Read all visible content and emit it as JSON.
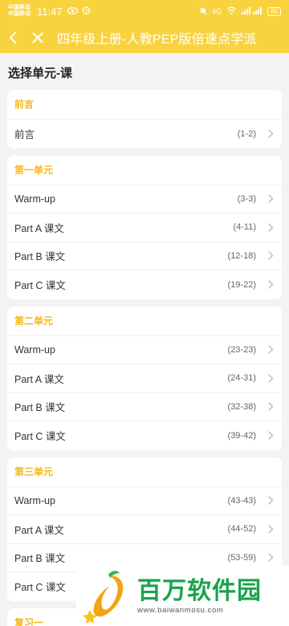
{
  "status_bar": {
    "carrier1": "中国移动",
    "carrier2": "中国移动",
    "time": "11:47",
    "network": "4G",
    "battery": "85"
  },
  "toolbar": {
    "title": "四年级上册-人教PEP版倍速点学派"
  },
  "heading": "选择单元-课",
  "units": [
    {
      "title": "前言",
      "lessons": [
        {
          "name": "前言",
          "range": "(1-2)"
        }
      ]
    },
    {
      "title": "第一单元",
      "lessons": [
        {
          "name": "Warm-up",
          "range": "(3-3)"
        },
        {
          "name": "Part A 课文",
          "range": "(4-11)"
        },
        {
          "name": "Part B 课文",
          "range": "(12-18)"
        },
        {
          "name": "Part C 课文",
          "range": "(19-22)"
        }
      ]
    },
    {
      "title": "第二单元",
      "lessons": [
        {
          "name": "Warm-up",
          "range": "(23-23)"
        },
        {
          "name": "Part A 课文",
          "range": "(24-31)"
        },
        {
          "name": "Part B 课文",
          "range": "(32-38)"
        },
        {
          "name": "Part C 课文",
          "range": "(39-42)"
        }
      ]
    },
    {
      "title": "第三单元",
      "lessons": [
        {
          "name": "Warm-up",
          "range": "(43-43)"
        },
        {
          "name": "Part A 课文",
          "range": "(44-52)"
        },
        {
          "name": "Part B 课文",
          "range": "(53-59)"
        },
        {
          "name": "Part C 课文",
          "range": ""
        }
      ]
    },
    {
      "title": "复习一",
      "lessons": []
    }
  ],
  "watermark": {
    "name": "百万软件园",
    "url": "www.baiwanmosu.com"
  },
  "colors": {
    "accent": "#f9d33f",
    "unit_title": "#f5b816",
    "watermark_green": "#1aa34a"
  }
}
